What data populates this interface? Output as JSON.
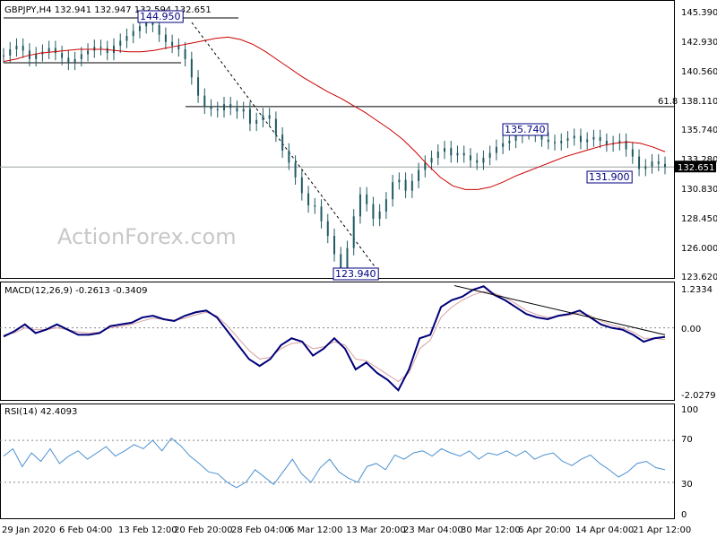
{
  "chart_data": [
    {
      "type": "candlestick",
      "title": "GBPJPY,H4  132.941 132.947 132.594 132.651",
      "watermark": "ActionForex.com",
      "ylim": [
        123.62,
        145.39
      ],
      "y_ticks": [
        "145.390",
        "142.930",
        "140.560",
        "138.110",
        "135.740",
        "133.280",
        "130.830",
        "128.450",
        "126.000",
        "123.620"
      ],
      "last_price": "132.651",
      "levels": [
        {
          "label": "144.950",
          "value": 144.95
        },
        {
          "label": "135.740",
          "value": 135.74
        },
        {
          "label": "131.900",
          "value": 131.9
        },
        {
          "label": "123.940",
          "value": 123.94
        }
      ],
      "fib_label": "61.8",
      "fib_value": 137.6,
      "close_series": [
        141.8,
        142.3,
        142.6,
        142.2,
        141.5,
        141.9,
        142.1,
        142.4,
        142.0,
        141.6,
        141.2,
        141.5,
        141.9,
        142.2,
        142.5,
        142.4,
        142.0,
        142.6,
        143.0,
        143.4,
        143.8,
        144.2,
        144.5,
        144.3,
        143.5,
        142.9,
        142.6,
        142.3,
        141.5,
        140.0,
        138.5,
        137.6,
        137.4,
        137.3,
        137.8,
        137.5,
        137.2,
        137.4,
        136.2,
        136.5,
        136.9,
        136.6,
        135.3,
        134.0,
        133.0,
        131.8,
        130.5,
        129.5,
        129.4,
        128.2,
        127.0,
        125.5,
        124.2,
        126.0,
        128.6,
        130.4,
        129.6,
        128.4,
        129.0,
        130.0,
        131.4,
        131.6,
        130.7,
        131.5,
        132.4,
        133.0,
        133.4,
        133.9,
        134.2,
        133.6,
        133.8,
        133.6,
        133.2,
        133.0,
        133.4,
        133.8,
        134.3,
        134.6,
        134.8,
        135.2,
        135.5,
        135.6,
        135.3,
        134.9,
        134.7,
        134.6,
        134.8,
        135.0,
        135.2,
        134.7,
        134.9,
        135.1,
        134.8,
        134.5,
        134.6,
        134.8,
        134.1,
        133.5,
        132.5,
        132.7,
        133.1,
        132.9,
        132.651
      ],
      "ma_series": [
        141.3,
        141.5,
        141.8,
        142.0,
        142.1,
        142.2,
        142.3,
        142.3,
        142.3,
        142.2,
        142.1,
        142.1,
        142.2,
        142.4,
        142.6,
        142.8,
        143.0,
        143.2,
        143.3,
        143.1,
        142.7,
        142.1,
        141.4,
        140.7,
        140.0,
        139.4,
        138.8,
        138.3,
        137.7,
        137.1,
        136.4,
        135.7,
        134.9,
        133.9,
        132.8,
        131.8,
        131.1,
        130.8,
        130.8,
        131.0,
        131.4,
        131.9,
        132.3,
        132.7,
        133.1,
        133.5,
        133.8,
        134.1,
        134.4,
        134.6,
        134.7,
        134.6,
        134.3,
        133.9
      ],
      "ma_x_start": 0,
      "ma_color": "#cc0000",
      "candle_color": "#1e5a64",
      "xlabel": "",
      "ylabel": ""
    },
    {
      "type": "line",
      "title": "MACD(12,26,9) -0.2613 -0.3409",
      "ylim": [
        -2.0279,
        1.2334
      ],
      "y_ticks": [
        "1.2334",
        "0.00",
        "-2.0279"
      ],
      "series": [
        {
          "values": [
            -0.25,
            -0.1,
            0.1,
            -0.15,
            -0.05,
            0.1,
            -0.05,
            -0.2,
            -0.2,
            -0.15,
            0.05,
            0.1,
            0.15,
            0.3,
            0.35,
            0.25,
            0.2,
            0.35,
            0.45,
            0.5,
            0.3,
            -0.1,
            -0.5,
            -0.9,
            -1.1,
            -0.9,
            -0.5,
            -0.3,
            -0.4,
            -0.8,
            -0.6,
            -0.3,
            -0.6,
            -1.2,
            -1.0,
            -1.3,
            -1.5,
            -1.8,
            -1.2,
            -0.3,
            -0.2,
            0.6,
            0.8,
            0.9,
            1.1,
            1.2,
            0.95,
            0.8,
            0.6,
            0.4,
            0.3,
            0.25,
            0.35,
            0.4,
            0.5,
            0.3,
            0.1,
            0.0,
            -0.05,
            -0.2,
            -0.4,
            -0.3,
            -0.26
          ]
        }
      ],
      "signal_series": [
        -0.2,
        -0.15,
        0.0,
        -0.05,
        -0.05,
        0.0,
        -0.05,
        -0.12,
        -0.15,
        -0.12,
        0.0,
        0.05,
        0.1,
        0.2,
        0.28,
        0.25,
        0.22,
        0.28,
        0.38,
        0.45,
        0.35,
        0.05,
        -0.3,
        -0.65,
        -0.9,
        -0.85,
        -0.6,
        -0.45,
        -0.42,
        -0.6,
        -0.55,
        -0.4,
        -0.5,
        -0.9,
        -0.95,
        -1.15,
        -1.35,
        -1.55,
        -1.3,
        -0.6,
        -0.35,
        0.3,
        0.6,
        0.8,
        0.95,
        1.05,
        1.0,
        0.88,
        0.7,
        0.5,
        0.38,
        0.3,
        0.33,
        0.37,
        0.43,
        0.35,
        0.2,
        0.08,
        0.0,
        -0.12,
        -0.3,
        -0.3,
        -0.34
      ],
      "signal_color": "#d8a0a0",
      "line_color": "#00007a"
    },
    {
      "type": "line",
      "title": "RSI(14) 42.4093",
      "ylim": [
        0,
        100
      ],
      "y_ticks": [
        "100",
        "70",
        "30",
        "0"
      ],
      "levels": [
        70,
        30
      ],
      "series": [
        {
          "values": [
            55,
            62,
            45,
            58,
            50,
            62,
            48,
            55,
            60,
            52,
            58,
            64,
            55,
            60,
            66,
            62,
            70,
            60,
            72,
            65,
            55,
            48,
            40,
            38,
            30,
            25,
            30,
            42,
            35,
            28,
            40,
            52,
            38,
            30,
            44,
            52,
            40,
            34,
            30,
            45,
            48,
            42,
            56,
            52,
            58,
            60,
            55,
            62,
            58,
            55,
            60,
            52,
            58,
            56,
            60,
            55,
            60,
            52,
            56,
            58,
            50,
            46,
            52,
            56,
            48,
            42,
            35,
            40,
            48,
            50,
            44,
            42
          ]
        }
      ],
      "line_color": "#4a90d0"
    }
  ],
  "x_ticks": [
    "29 Jan 2020",
    "6 Feb 04:00",
    "13 Feb 12:00",
    "20 Feb 20:00",
    "28 Feb 04:00",
    "6 Mar 12:00",
    "13 Mar 20:00",
    "23 Mar 04:00",
    "30 Mar 12:00",
    "6 Apr 20:00",
    "14 Apr 04:00",
    "21 Apr 12:00"
  ]
}
